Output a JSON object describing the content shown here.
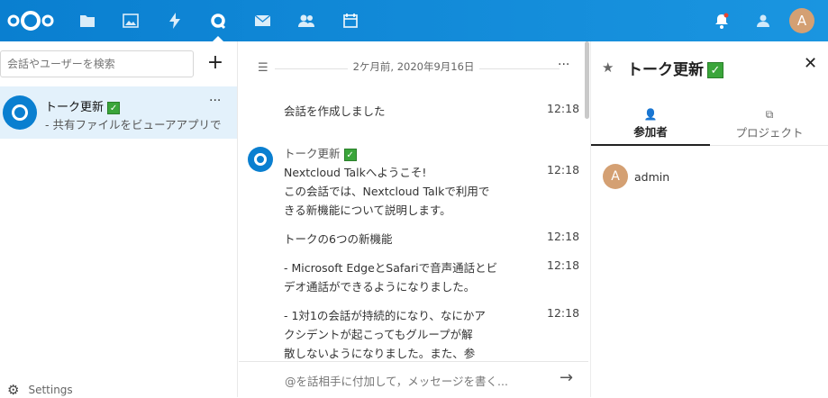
{
  "topbar": {
    "accent": "#0a7fd0",
    "apps": [
      "files-icon",
      "photos-icon",
      "activity-icon",
      "talk-icon",
      "mail-icon",
      "contacts-icon",
      "calendar-icon"
    ],
    "avatar_letter": "A"
  },
  "sidebar": {
    "search_placeholder": "会話やユーザーを検索",
    "conversation": {
      "name": "トーク更新",
      "badge": "✓",
      "preview": "- 共有ファイルをビューアアプリで",
      "more": "···"
    },
    "settings_label": "Settings"
  },
  "chat": {
    "date_label": "2ケ月前, 2020年9月16日",
    "system_message": "会話を作成しました",
    "system_time": "12:18",
    "author": "トーク更新",
    "messages": [
      {
        "text": "Nextcloud Talkへようこそ!",
        "time": "12:18"
      },
      {
        "text": "この会話では、Nextcloud Talkで利用で",
        "time": ""
      },
      {
        "text": "きる新機能について説明します。",
        "time": ""
      },
      {
        "text": "トークの6つの新機能",
        "time": "12:18"
      },
      {
        "text": "- Microsoft EdgeとSafariで音声通話とビ",
        "time": "12:18"
      },
      {
        "text": "デオ通話ができるようになりました。",
        "time": ""
      },
      {
        "text": "- 1対1の会話が持続的になり、なにかア",
        "time": "12:18"
      },
      {
        "text": "クシデントが起こってもグループが解",
        "time": ""
      },
      {
        "text": "散しないようになりました。また、参",
        "time": ""
      }
    ],
    "input_placeholder": "@を話相手に付加して，メッセージを書く..."
  },
  "details": {
    "title": "トーク更新",
    "tab_participants": "参加者",
    "tab_projects": "プロジェクト",
    "participant_initial": "A",
    "participant_name": "admin"
  }
}
